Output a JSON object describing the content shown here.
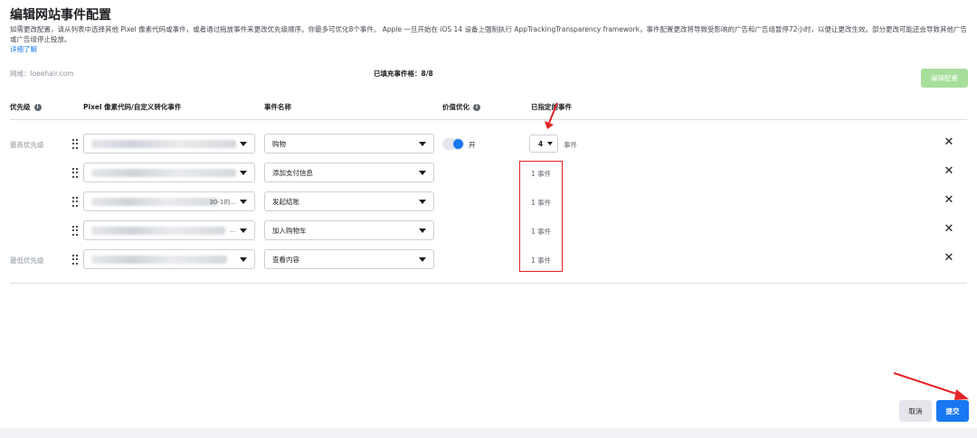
{
  "header": {
    "title": "编辑网站事件配置",
    "description": "如需更改配置，请从列表中选择其他 Pixel 像素代码或事件，或者通过拖放事件来更改优先级顺序。你最多可优化8个事件。 Apple 一旦开始在 iOS 14 设备上强制执行 AppTrackingTransparency framework，事件配置更改将导致受影响的广告和广告组暂停72小时，以便让更改生效。部分更改可能还会导致其他广告或广告组停止投放。",
    "learn_more": "详细了解"
  },
  "toolbar": {
    "domain": "网域：loeehair.com",
    "filled_count": "已填充事件格：8/8",
    "edit_button": "编辑配置"
  },
  "columns": {
    "priority": "优先级",
    "pixel": "Pixel 像素代码/自定义转化事件",
    "event_name": "事件名称",
    "value_optimization": "价值优化",
    "assigned_events": "已指定的事件"
  },
  "rows": [
    {
      "priority": "最高优先级",
      "pixel_tail": "",
      "event": "购物",
      "value_opt_label": "开",
      "assigned_count": "4",
      "assigned_unit": "事件"
    },
    {
      "priority": "",
      "pixel_tail": "",
      "event": "添加支付信息",
      "assigned_text": "1 事件"
    },
    {
      "priority": "",
      "pixel_tail": "30-1的...",
      "event": "发起结账",
      "assigned_text": "1 事件"
    },
    {
      "priority": "",
      "pixel_tail": "...",
      "event": "加入购物车",
      "assigned_text": "1 事件"
    },
    {
      "priority": "最低优先级",
      "pixel_tail": "",
      "event": "查看内容",
      "assigned_text": "1 事件"
    }
  ],
  "footer": {
    "cancel": "取消",
    "submit": "提交"
  },
  "colors": {
    "primary": "#1877f2",
    "disabled_green": "#a6de9b",
    "annotation_red": "#e02424"
  }
}
